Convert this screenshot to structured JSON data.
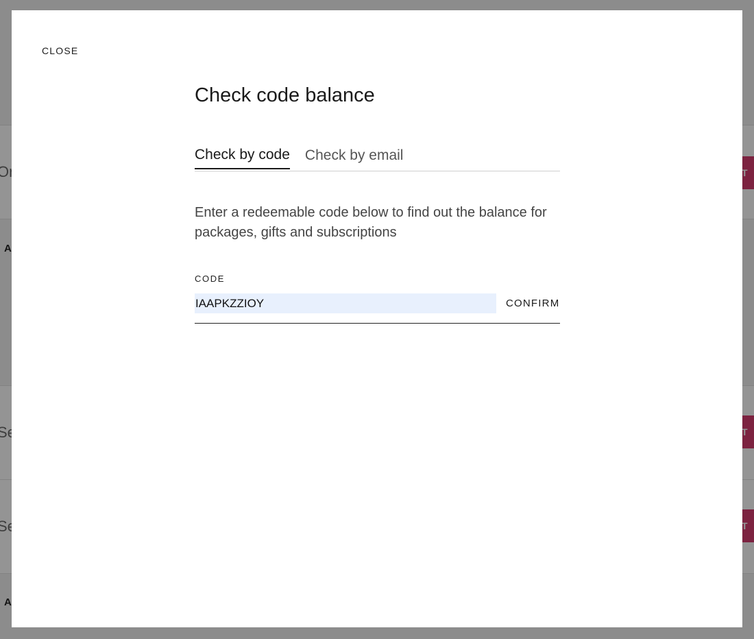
{
  "background": {
    "row_texts": [
      "Or",
      "Se",
      "Se"
    ],
    "small_labels": [
      "A",
      "A"
    ],
    "pink_button_label": "T"
  },
  "modal": {
    "close_label": "CLOSE",
    "title": "Check code balance",
    "tabs": [
      {
        "label": "Check by code",
        "active": true
      },
      {
        "label": "Check by email",
        "active": false
      }
    ],
    "description": "Enter a redeemable code below to find out the balance for packages, gifts and subscriptions",
    "code_label": "CODE",
    "code_value": "IAAPKZZIOY",
    "confirm_label": "CONFIRM"
  },
  "colors": {
    "accent_pink": "#d63b6e",
    "autofill_bg": "#e8f0fd"
  }
}
